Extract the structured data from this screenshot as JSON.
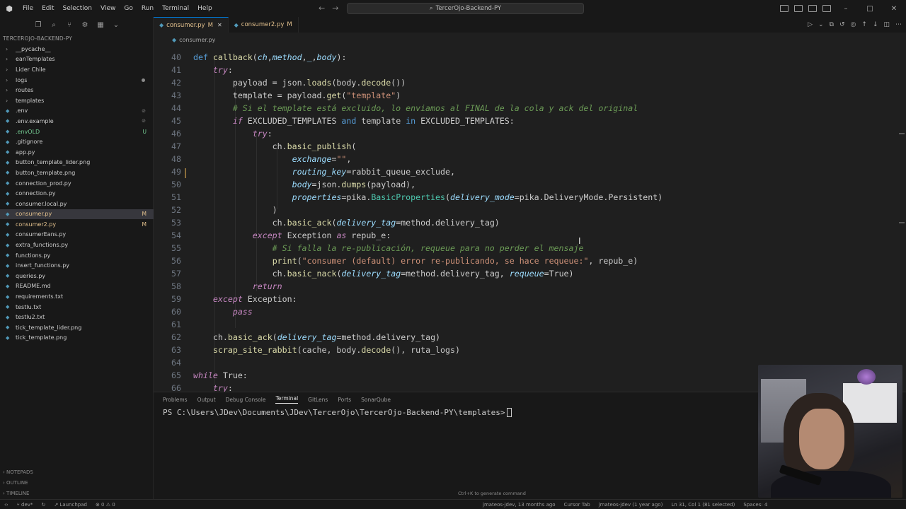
{
  "titlebar": {
    "menu": [
      "File",
      "Edit",
      "Selection",
      "View",
      "Go",
      "Run",
      "Terminal",
      "Help"
    ],
    "search_text": "TercerOjo-Backend-PY"
  },
  "explorer": {
    "title": "TERCEROJO-BACKEND-PY",
    "items": [
      {
        "label": "__pycache__",
        "folder": true,
        "badge": "",
        "active": false
      },
      {
        "label": "eanTemplates",
        "folder": true,
        "badge": "",
        "active": false
      },
      {
        "label": "Lider Chile",
        "folder": true,
        "badge": "",
        "active": false
      },
      {
        "label": "logs",
        "folder": true,
        "badge": "dot",
        "active": false
      },
      {
        "label": "routes",
        "folder": true,
        "badge": "",
        "active": false
      },
      {
        "label": "templates",
        "folder": true,
        "badge": "",
        "active": false
      },
      {
        "label": ".env",
        "folder": false,
        "badge": "gear",
        "active": false
      },
      {
        "label": ".env.example",
        "folder": false,
        "badge": "gear",
        "active": false
      },
      {
        "label": ".envOLD",
        "folder": false,
        "badge": "U",
        "active": false
      },
      {
        "label": ".gitignore",
        "folder": false,
        "badge": "",
        "active": false
      },
      {
        "label": "app.py",
        "folder": false,
        "badge": "",
        "active": false
      },
      {
        "label": "button_template_lider.png",
        "folder": false,
        "badge": "",
        "active": false
      },
      {
        "label": "button_template.png",
        "folder": false,
        "badge": "",
        "active": false
      },
      {
        "label": "connection_prod.py",
        "folder": false,
        "badge": "",
        "active": false
      },
      {
        "label": "connection.py",
        "folder": false,
        "badge": "",
        "active": false
      },
      {
        "label": "consumer.local.py",
        "folder": false,
        "badge": "",
        "active": false
      },
      {
        "label": "consumer.py",
        "folder": false,
        "badge": "M",
        "active": true
      },
      {
        "label": "consumer2.py",
        "folder": false,
        "badge": "M",
        "active": false
      },
      {
        "label": "consumerEans.py",
        "folder": false,
        "badge": "",
        "active": false
      },
      {
        "label": "extra_functions.py",
        "folder": false,
        "badge": "",
        "active": false
      },
      {
        "label": "functions.py",
        "folder": false,
        "badge": "",
        "active": false
      },
      {
        "label": "insert_functions.py",
        "folder": false,
        "badge": "",
        "active": false
      },
      {
        "label": "queries.py",
        "folder": false,
        "badge": "",
        "active": false
      },
      {
        "label": "README.md",
        "folder": false,
        "badge": "",
        "active": false
      },
      {
        "label": "requirements.txt",
        "folder": false,
        "badge": "",
        "active": false
      },
      {
        "label": "testlu.txt",
        "folder": false,
        "badge": "",
        "active": false
      },
      {
        "label": "testlu2.txt",
        "folder": false,
        "badge": "",
        "active": false
      },
      {
        "label": "tick_template_lider.png",
        "folder": false,
        "badge": "",
        "active": false
      },
      {
        "label": "tick_template.png",
        "folder": false,
        "badge": "",
        "active": false
      }
    ],
    "sections": [
      "NOTEPADS",
      "OUTLINE",
      "TIMELINE"
    ]
  },
  "tabs": [
    {
      "label": "consumer.py",
      "modified": "M",
      "active": true
    },
    {
      "label": "consumer2.py",
      "modified": "M",
      "active": false
    }
  ],
  "breadcrumb": "consumer.py",
  "code": [
    {
      "n": "40",
      "t": [
        [
          "kw",
          "def "
        ],
        [
          "fn",
          "callback"
        ],
        [
          "var",
          "("
        ],
        [
          "param",
          "ch"
        ],
        [
          "var",
          ","
        ],
        [
          "param",
          "method"
        ],
        [
          "var",
          ","
        ],
        [
          "param",
          "_"
        ],
        [
          "var",
          ","
        ],
        [
          "param",
          "body"
        ],
        [
          "var",
          "):"
        ]
      ]
    },
    {
      "n": "41",
      "t": [
        [
          "var",
          "    "
        ],
        [
          "kc",
          "try"
        ],
        [
          "var",
          ":"
        ]
      ]
    },
    {
      "n": "42",
      "t": [
        [
          "var",
          "        payload = json."
        ],
        [
          "fn",
          "loads"
        ],
        [
          "var",
          "(body."
        ],
        [
          "fn",
          "decode"
        ],
        [
          "var",
          "())"
        ]
      ]
    },
    {
      "n": "43",
      "t": [
        [
          "var",
          "        template = payload."
        ],
        [
          "fn",
          "get"
        ],
        [
          "var",
          "("
        ],
        [
          "str",
          "\"template\""
        ],
        [
          "var",
          ")"
        ]
      ]
    },
    {
      "n": "44",
      "t": [
        [
          "cmt",
          "        # Si el template está excluido, lo enviamos al FINAL de la cola y ack del original"
        ]
      ]
    },
    {
      "n": "45",
      "t": [
        [
          "var",
          "        "
        ],
        [
          "kc",
          "if"
        ],
        [
          "var",
          " EXCLUDED_TEMPLATES "
        ],
        [
          "kw",
          "and"
        ],
        [
          "var",
          " template "
        ],
        [
          "kw",
          "in"
        ],
        [
          "var",
          " EXCLUDED_TEMPLATES:"
        ]
      ]
    },
    {
      "n": "46",
      "t": [
        [
          "var",
          "            "
        ],
        [
          "kc",
          "try"
        ],
        [
          "var",
          ":"
        ]
      ]
    },
    {
      "n": "47",
      "t": [
        [
          "var",
          "                ch."
        ],
        [
          "fn",
          "basic_publish"
        ],
        [
          "var",
          "("
        ]
      ]
    },
    {
      "n": "48",
      "t": [
        [
          "var",
          "                    "
        ],
        [
          "param",
          "exchange"
        ],
        [
          "var",
          "="
        ],
        [
          "str",
          "\"\""
        ],
        [
          "var",
          ","
        ]
      ]
    },
    {
      "n": "49",
      "t": [
        [
          "var",
          "                    "
        ],
        [
          "param",
          "routing_key"
        ],
        [
          "var",
          "=rabbit_queue_exclude,"
        ]
      ]
    },
    {
      "n": "50",
      "t": [
        [
          "var",
          "                    "
        ],
        [
          "param",
          "body"
        ],
        [
          "var",
          "=json."
        ],
        [
          "fn",
          "dumps"
        ],
        [
          "var",
          "(payload),"
        ]
      ]
    },
    {
      "n": "51",
      "t": [
        [
          "var",
          "                    "
        ],
        [
          "param",
          "properties"
        ],
        [
          "var",
          "=pika."
        ],
        [
          "cls",
          "BasicProperties"
        ],
        [
          "var",
          "("
        ],
        [
          "param",
          "delivery_mode"
        ],
        [
          "var",
          "=pika.DeliveryMode.Persistent)"
        ]
      ]
    },
    {
      "n": "52",
      "t": [
        [
          "var",
          "                )"
        ]
      ]
    },
    {
      "n": "53",
      "t": [
        [
          "var",
          "                ch."
        ],
        [
          "fn",
          "basic_ack"
        ],
        [
          "var",
          "("
        ],
        [
          "param",
          "delivery_tag"
        ],
        [
          "var",
          "=method.delivery_tag)"
        ]
      ]
    },
    {
      "n": "54",
      "t": [
        [
          "var",
          "            "
        ],
        [
          "kc",
          "except"
        ],
        [
          "var",
          " Exception "
        ],
        [
          "kc",
          "as"
        ],
        [
          "var",
          " repub_e:"
        ]
      ]
    },
    {
      "n": "55",
      "t": [
        [
          "cmt",
          "                # Si falla la re-publicación, requeue para no perder el mensaje"
        ]
      ]
    },
    {
      "n": "56",
      "t": [
        [
          "var",
          "                "
        ],
        [
          "fn",
          "print"
        ],
        [
          "var",
          "("
        ],
        [
          "str",
          "\"consumer (default) error re-publicando, se hace requeue:\""
        ],
        [
          "var",
          ", repub_e)"
        ]
      ]
    },
    {
      "n": "57",
      "t": [
        [
          "var",
          "                ch."
        ],
        [
          "fn",
          "basic_nack"
        ],
        [
          "var",
          "("
        ],
        [
          "param",
          "delivery_tag"
        ],
        [
          "var",
          "=method.delivery_tag, "
        ],
        [
          "param",
          "requeue"
        ],
        [
          "var",
          "=True)"
        ]
      ]
    },
    {
      "n": "58",
      "t": [
        [
          "var",
          "            "
        ],
        [
          "kc",
          "return"
        ]
      ]
    },
    {
      "n": "59",
      "t": [
        [
          "var",
          "    "
        ],
        [
          "kc",
          "except"
        ],
        [
          "var",
          " Exception:"
        ]
      ]
    },
    {
      "n": "60",
      "t": [
        [
          "var",
          "        "
        ],
        [
          "kc",
          "pass"
        ]
      ]
    },
    {
      "n": "61",
      "t": []
    },
    {
      "n": "62",
      "t": [
        [
          "var",
          "    ch."
        ],
        [
          "fn",
          "basic_ack"
        ],
        [
          "var",
          "("
        ],
        [
          "param",
          "delivery_tag"
        ],
        [
          "var",
          "=method.delivery_tag)"
        ]
      ]
    },
    {
      "n": "63",
      "t": [
        [
          "var",
          "    "
        ],
        [
          "fn",
          "scrap_site_rabbit"
        ],
        [
          "var",
          "(cache, body."
        ],
        [
          "fn",
          "decode"
        ],
        [
          "var",
          "(), ruta_logs)"
        ]
      ]
    },
    {
      "n": "64",
      "t": []
    },
    {
      "n": "65",
      "t": [
        [
          "kc",
          "while"
        ],
        [
          "var",
          " True:"
        ]
      ]
    },
    {
      "n": "66",
      "t": [
        [
          "var",
          "    "
        ],
        [
          "kc",
          "try"
        ],
        [
          "var",
          ":"
        ]
      ]
    }
  ],
  "panel": {
    "tabs": [
      "Problems",
      "Output",
      "Debug Console",
      "Terminal",
      "GitLens",
      "Ports",
      "SonarQube"
    ],
    "active_tab": "Terminal",
    "prompt": "PS C:\\Users\\JDev\\Documents\\JDev\\TercerOjo\\TercerOjo-Backend-PY\\templates>",
    "hint": "Ctrl+K to generate command"
  },
  "statusbar": {
    "branch": "dev*",
    "launchpad": "Launchpad",
    "problems": "0",
    "warnings": "0",
    "blame": "jmateos-jdev, 13 months ago",
    "cursor_tab": "Cursor Tab",
    "author": "jmateos-jdev (1 year ago)",
    "position": "Ln 31, Col 1 (81 selected)",
    "spaces": "Spaces: 4"
  }
}
